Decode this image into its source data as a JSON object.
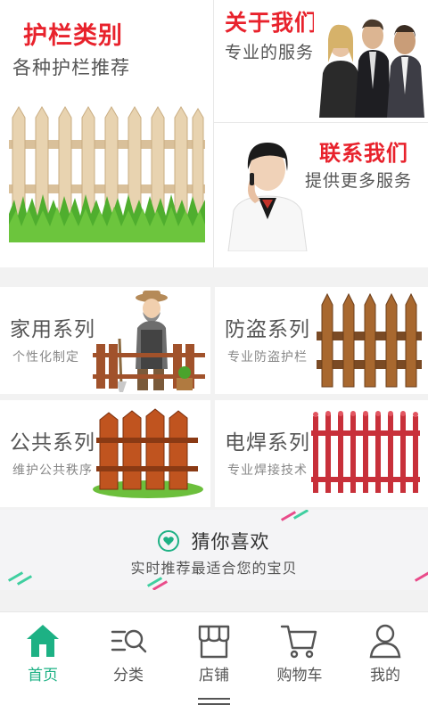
{
  "promo": {
    "category": {
      "title": "护栏类别",
      "subtitle": "各种护栏推荐"
    },
    "about": {
      "title": "关于我们",
      "subtitle": "专业的服务"
    },
    "contact": {
      "title": "联系我们",
      "subtitle": "提供更多服务"
    }
  },
  "series": [
    {
      "title": "家用系列",
      "subtitle": "个性化制定"
    },
    {
      "title": "防盗系列",
      "subtitle": "专业防盗护栏"
    },
    {
      "title": "公共系列",
      "subtitle": "维护公共秩序"
    },
    {
      "title": "电焊系列",
      "subtitle": "专业焊接技术"
    }
  ],
  "guess": {
    "icon": "heart-icon",
    "title": "猜你喜欢",
    "subtitle": "实时推荐最适合您的宝贝"
  },
  "tabs": [
    {
      "label": "首页",
      "icon": "home-icon",
      "active": true
    },
    {
      "label": "分类",
      "icon": "category-icon",
      "active": false
    },
    {
      "label": "店铺",
      "icon": "store-icon",
      "active": false
    },
    {
      "label": "购物车",
      "icon": "cart-icon",
      "active": false
    },
    {
      "label": "我的",
      "icon": "profile-icon",
      "active": false
    }
  ],
  "colors": {
    "accent": "#1db184",
    "headline_red": "#e8222c",
    "text": "#555555"
  }
}
